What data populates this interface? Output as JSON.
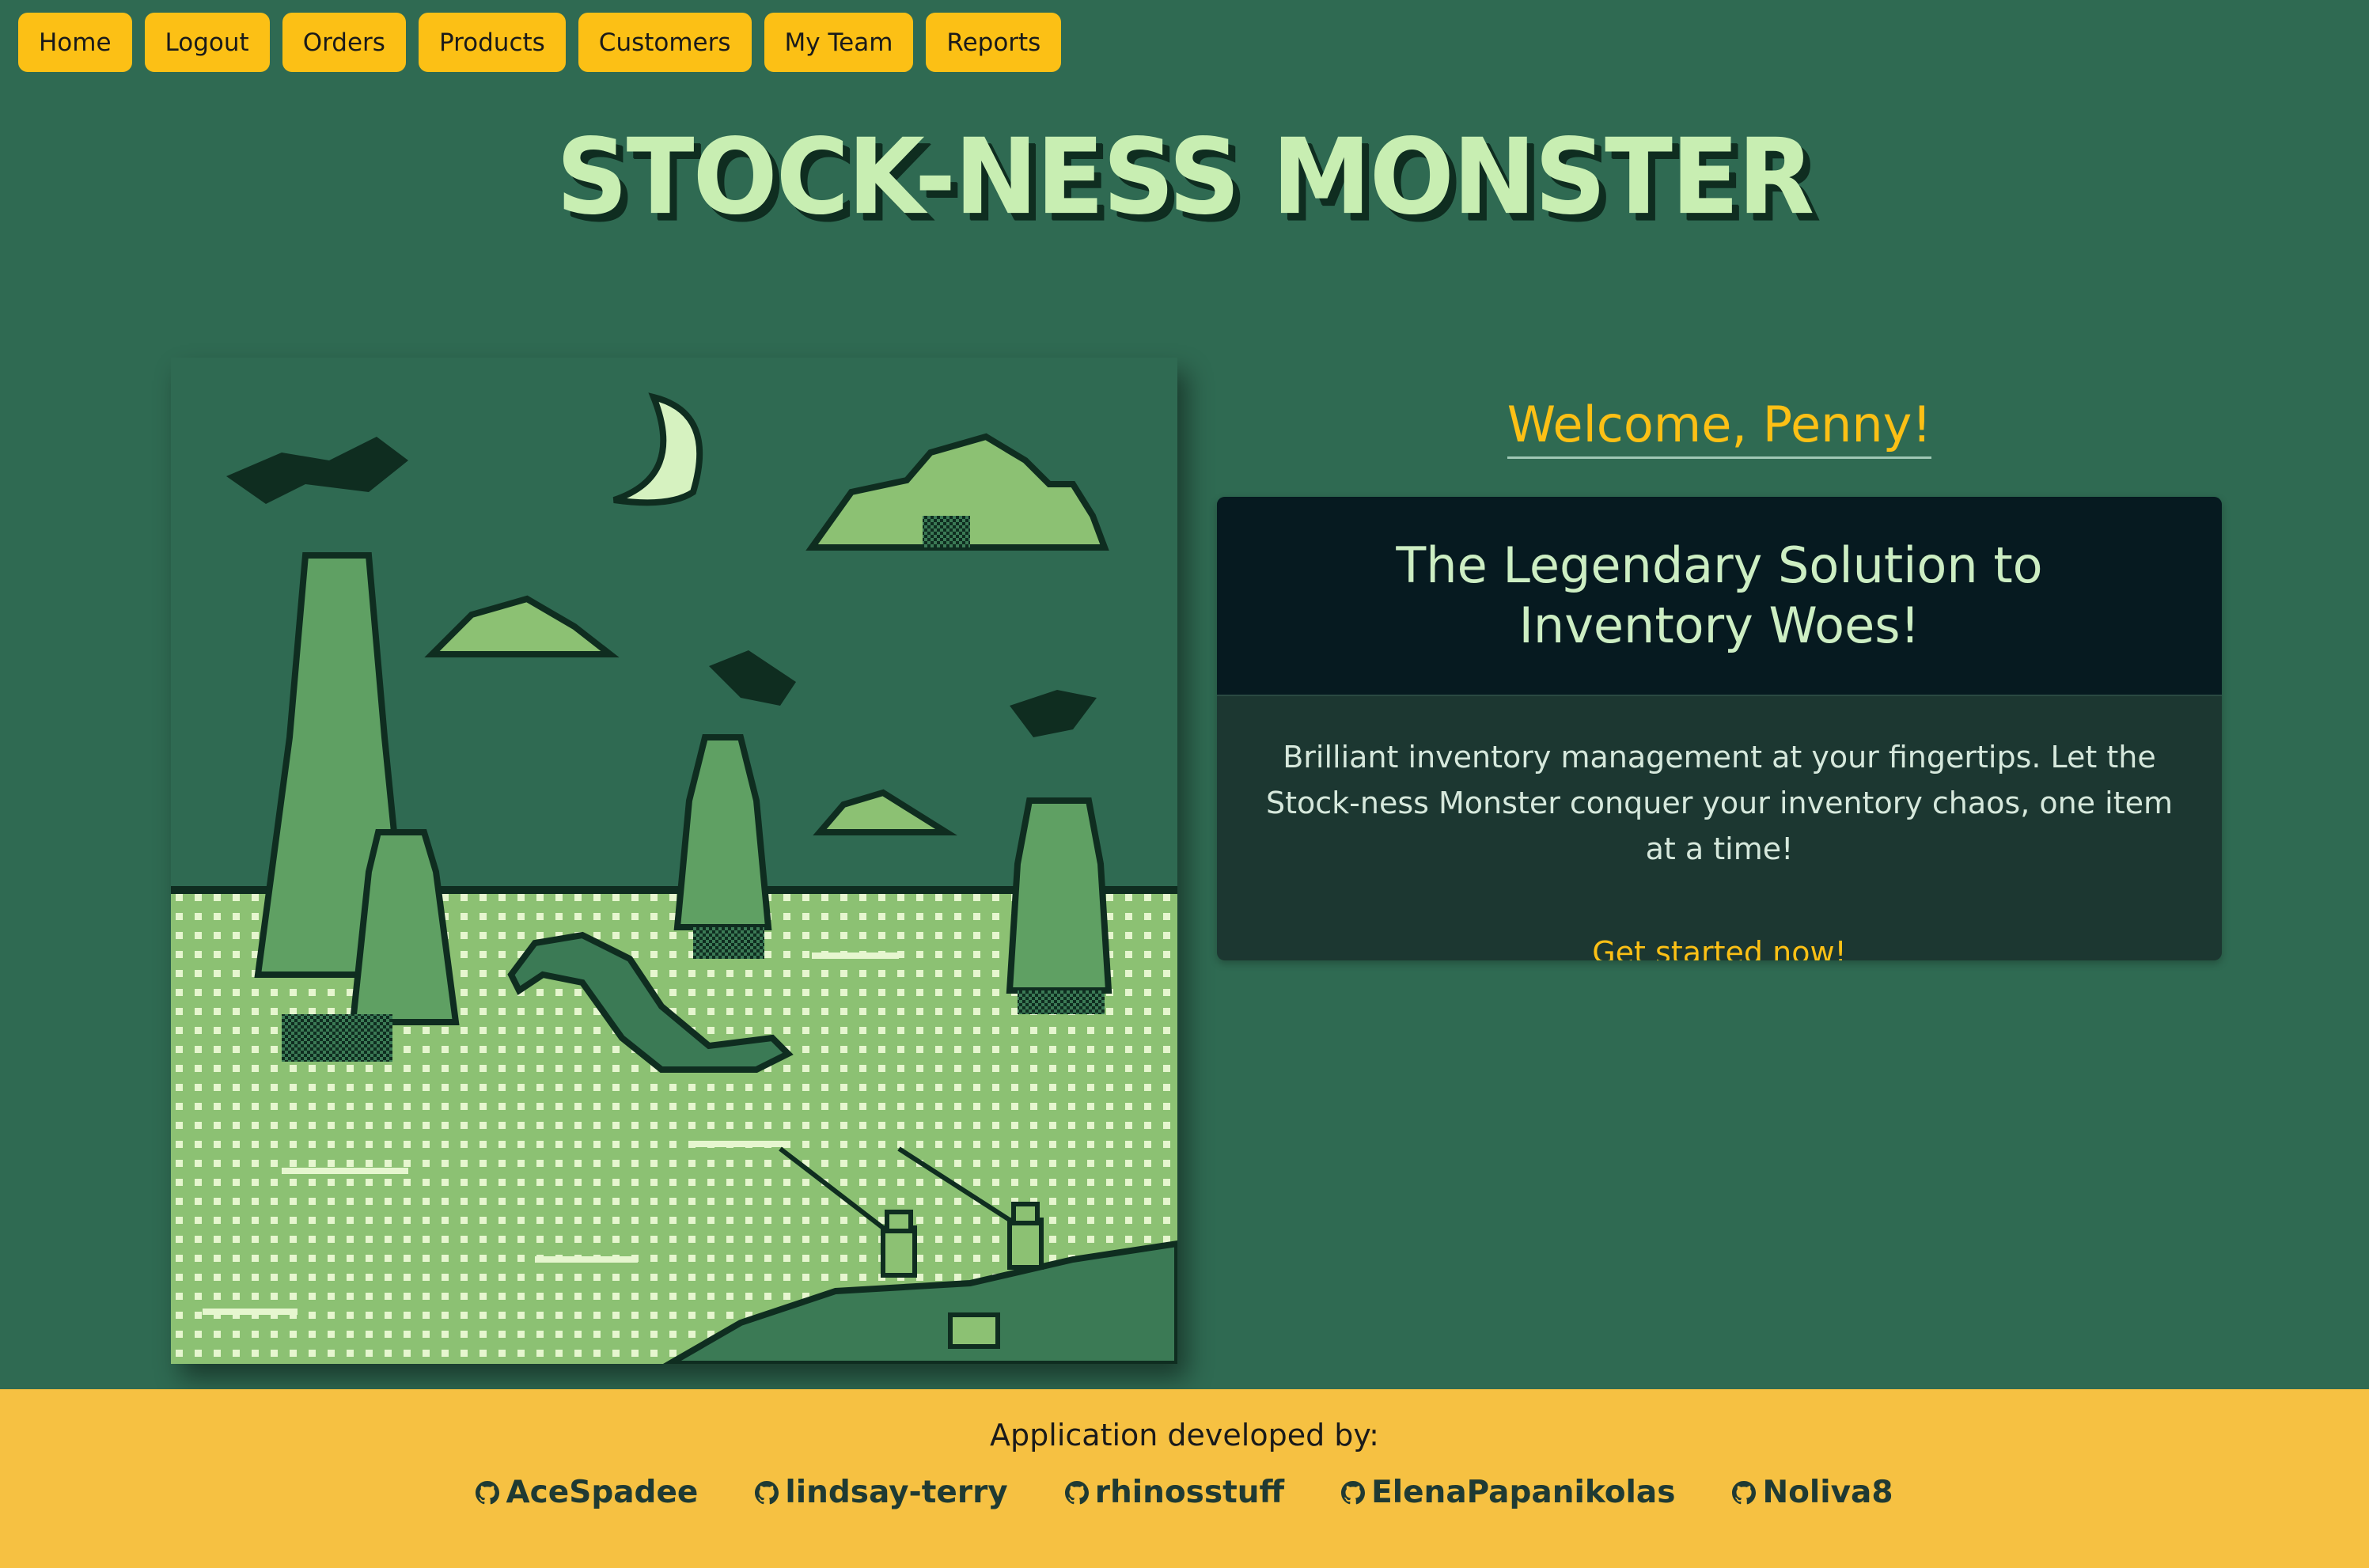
{
  "nav": {
    "items": [
      {
        "label": "Home"
      },
      {
        "label": "Logout"
      },
      {
        "label": "Orders"
      },
      {
        "label": "Products"
      },
      {
        "label": "Customers"
      },
      {
        "label": "My Team"
      },
      {
        "label": "Reports"
      }
    ]
  },
  "header": {
    "title": "STOCK-NESS MONSTER"
  },
  "welcome": {
    "text": "Welcome, Penny!"
  },
  "card": {
    "title": "The Legendary Solution to Inventory Woes!",
    "body": "Brilliant inventory management at your fingertips. Let the Stock-ness Monster conquer your inventory chaos, one item at a time!",
    "cta": "Get started now!"
  },
  "footer": {
    "title": "Application developed by:",
    "developers": [
      {
        "name": "AceSpadee",
        "icon": "github-icon"
      },
      {
        "name": "lindsay-terry",
        "icon": "github-icon"
      },
      {
        "name": "rhinosstuff",
        "icon": "github-icon"
      },
      {
        "name": "ElenaPapanikolas",
        "icon": "github-icon"
      },
      {
        "name": "Noliva8",
        "icon": "github-icon"
      }
    ]
  },
  "colors": {
    "background": "#2f6a52",
    "accent": "#fcc015",
    "title": "#c8eeb2",
    "card_header": "#061a20",
    "card_body": "#1c3731",
    "footer": "#f6c142"
  }
}
